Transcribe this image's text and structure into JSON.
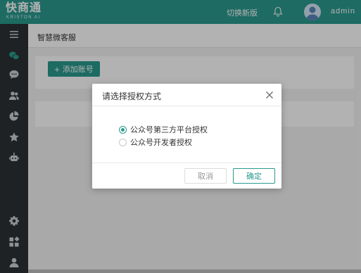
{
  "header": {
    "logo_text": "快商通",
    "logo_sub": "KRISTON AI",
    "switch_label": "切换新版",
    "username": "admin"
  },
  "sidebar": {
    "icons": [
      "menu-icon",
      "wechat-icon",
      "chat-icon",
      "users-icon",
      "pie-chart-icon",
      "star-icon",
      "robot-icon",
      "settings-icon",
      "apps-icon",
      "user-icon"
    ]
  },
  "main": {
    "breadcrumb": "智慧微客服",
    "add_account_label": "添加账号"
  },
  "modal": {
    "title": "请选择授权方式",
    "options": [
      {
        "label": "公众号第三方平台授权",
        "checked": true
      },
      {
        "label": "公众号开发者授权",
        "checked": false
      }
    ],
    "cancel_label": "取消",
    "ok_label": "确定"
  },
  "colors": {
    "primary": "#2a9a8e",
    "sidebar": "#2b3134"
  }
}
